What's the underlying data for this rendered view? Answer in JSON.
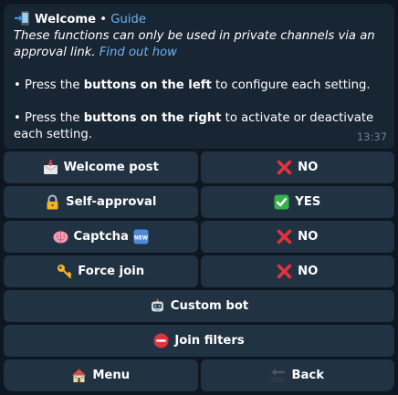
{
  "message": {
    "title": "Welcome",
    "separator": " • ",
    "guide_link": "Guide",
    "intro_italic": "These functions can only be used in private channels via an approval link.",
    "find_out_link": "Find out how",
    "p1_pre": "• Press the ",
    "p1_bold": "buttons on the left",
    "p1_post": " to configure each setting.",
    "p2_pre": "• Press the ",
    "p2_bold": "buttons on the right",
    "p2_post": " to activate or deactivate each setting.",
    "time": "13:37"
  },
  "keyboard": {
    "welcome_post": "Welcome post",
    "welcome_post_value": "NO",
    "self_approval": "Self-approval",
    "self_approval_value": "YES",
    "captcha": "Captcha",
    "captcha_value": "NO",
    "force_join": "Force join",
    "force_join_value": "NO",
    "custom_bot": "Custom bot",
    "join_filters": "Join filters",
    "menu": "Menu",
    "back": "Back"
  },
  "icons": {
    "title": "mobile-arrow-in-icon",
    "welcome_post": "incoming-envelope-icon",
    "self_approval": "lock-icon",
    "captcha": "brain-icon",
    "captcha_badge": "new-badge-icon",
    "no": "cross-mark-icon",
    "yes": "check-mark-icon",
    "force_join": "key-icon",
    "custom_bot": "robot-icon",
    "join_filters": "no-entry-icon",
    "menu": "house-icon",
    "back": "back-arrow-icon"
  },
  "colors": {
    "background": "#0e1621",
    "bubble": "#182533",
    "button": "#213242",
    "link": "#6ab3f3",
    "time": "#6d7f8f",
    "no_red": "#e2323c",
    "yes_green": "#36b24a"
  }
}
